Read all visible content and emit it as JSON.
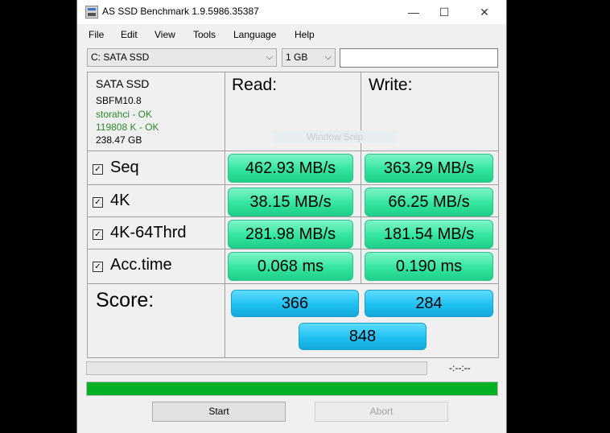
{
  "window": {
    "title": "AS SSD Benchmark 1.9.5986.35387",
    "minimize": "—",
    "maximize": "☐",
    "close": "✕"
  },
  "menu": [
    "File",
    "Edit",
    "View",
    "Tools",
    "Language",
    "Help"
  ],
  "drive_select": {
    "value": "C: SATA SSD",
    "arrow": "⌵"
  },
  "size_select": {
    "value": "1 GB",
    "arrow": "⌵"
  },
  "info": {
    "name": "SATA SSD",
    "firmware": "SBFM10.8",
    "driver": "storahci - OK",
    "alignment": "119808 K - OK",
    "capacity": "238.47 GB"
  },
  "headers": {
    "read": "Read:",
    "write": "Write:"
  },
  "overlay": "Window Snip",
  "rows": [
    {
      "label": "Seq",
      "read": "462.93 MB/s",
      "write": "363.29 MB/s"
    },
    {
      "label": "4K",
      "read": "38.15 MB/s",
      "write": "66.25 MB/s"
    },
    {
      "label": "4K-64Thrd",
      "read": "281.98 MB/s",
      "write": "181.54 MB/s"
    },
    {
      "label": "Acc.time",
      "read": "0.068 ms",
      "write": "0.190 ms"
    }
  ],
  "checkbox_glyph": "✓",
  "score": {
    "label": "Score:",
    "read": "366",
    "write": "284",
    "total": "848"
  },
  "time_display": "-:--:--",
  "progress_fraction": 1.0,
  "buttons": {
    "start": "Start",
    "abort": "Abort"
  },
  "colors": {
    "result_green": "#33e59e",
    "score_blue": "#1fc0f0",
    "progress_green": "#06b025"
  }
}
